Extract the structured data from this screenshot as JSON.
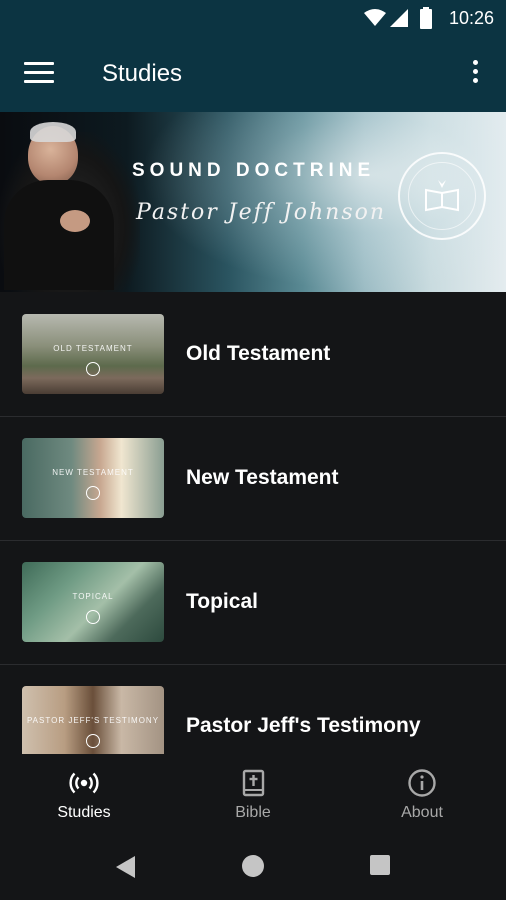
{
  "status": {
    "time": "10:26"
  },
  "appbar": {
    "title": "Studies"
  },
  "banner": {
    "heading": "SOUND DOCTRINE",
    "subtitle": "Pastor Jeff Johnson"
  },
  "studies": [
    {
      "label": "Old Testament",
      "thumb_text": "OLD TESTAMENT"
    },
    {
      "label": "New Testament",
      "thumb_text": "NEW TESTAMENT"
    },
    {
      "label": "Topical",
      "thumb_text": "TOPICAL"
    },
    {
      "label": "Pastor Jeff's Testimony",
      "thumb_text": "PASTOR JEFF'S TESTIMONY"
    }
  ],
  "bottom_nav": {
    "items": [
      {
        "label": "Studies",
        "icon": "broadcast-icon",
        "active": true
      },
      {
        "label": "Bible",
        "icon": "bible-icon",
        "active": false
      },
      {
        "label": "About",
        "icon": "info-icon",
        "active": false
      }
    ]
  },
  "colors": {
    "appbar": "#0c3442",
    "background": "#141517",
    "active_nav": "#ffffff",
    "inactive_nav": "#a8a8a8"
  }
}
